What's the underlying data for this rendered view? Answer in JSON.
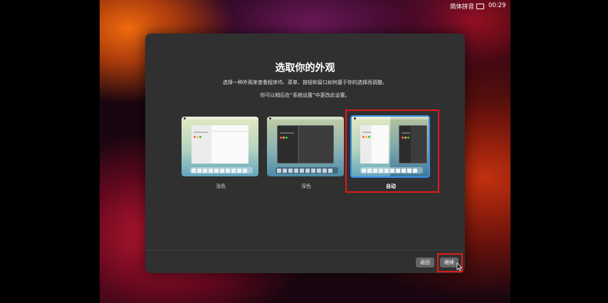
{
  "menubar": {
    "input_method": "简体拼音",
    "clock": "00:29"
  },
  "dialog": {
    "title": "选取你的外观",
    "description": "选择一种外观来查看程序坞、菜单、按钮和窗口如何基于你的选择而调整。",
    "hint": "你可以稍后在“系统设置”中更改此设置。",
    "options": [
      {
        "label": "浅色",
        "selected": false
      },
      {
        "label": "深色",
        "selected": false
      },
      {
        "label": "自动",
        "selected": true
      }
    ],
    "buttons": {
      "back": "返回",
      "continue": "继续"
    }
  },
  "colors": {
    "accent": "#3a8ee8",
    "highlight": "#e21a1a",
    "dialog_bg": "#303030"
  }
}
